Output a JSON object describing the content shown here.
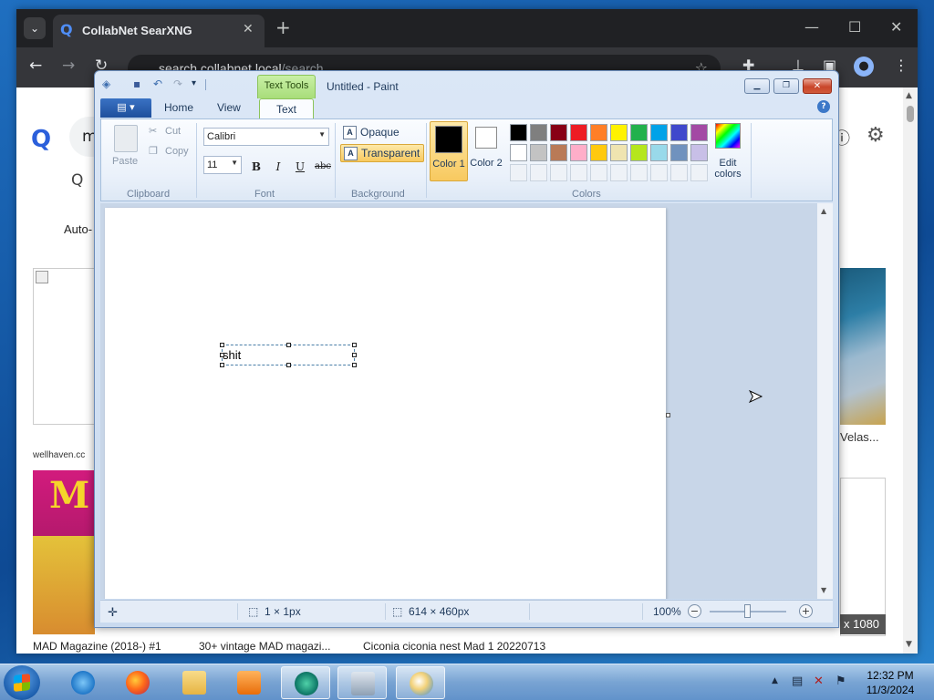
{
  "browser": {
    "tab_title": "CollabNet SearXNG",
    "tab_close": "✕",
    "new_tab": "+",
    "omnibox_host": "search.collabnet.local",
    "omnibox_path": "/search",
    "search_query_fragment": "m",
    "safe_search_label": "Auto-",
    "tile_source": "wellhaven.cc",
    "right_caption": "Velas...",
    "resolution_badge": "x 1080",
    "captions": [
      "MAD Magazine (2018-) #1",
      "30+ vintage MAD magazi...",
      "Ciconia ciconia nest Mad 1 20220713"
    ]
  },
  "paint": {
    "title": "Untitled - Paint",
    "context_tab": "Text Tools",
    "tabs": {
      "home": "Home",
      "view": "View",
      "text": "Text"
    },
    "clipboard": {
      "paste": "Paste",
      "cut": "Cut",
      "copy": "Copy",
      "group": "Clipboard"
    },
    "font": {
      "family": "Calibri",
      "size": "11",
      "bold": "B",
      "italic": "I",
      "underline": "U",
      "strike": "abc",
      "group": "Font"
    },
    "background": {
      "opaque": "Opaque",
      "transparent": "Transparent",
      "group": "Background",
      "selected": "Transparent"
    },
    "colors": {
      "color1_label": "Color 1",
      "color2_label": "Color 2",
      "color1": "#000000",
      "color2": "#ffffff",
      "edit_label": "Edit colors",
      "group": "Colors",
      "palette_row1": [
        "#000000",
        "#7f7f7f",
        "#880015",
        "#ed1c24",
        "#ff7f27",
        "#fff200",
        "#22b14c",
        "#00a2e8",
        "#3f48cc",
        "#a349a4"
      ],
      "palette_row2": [
        "#ffffff",
        "#c3c3c3",
        "#b97a57",
        "#ffaec9",
        "#ffc90e",
        "#efe4b0",
        "#b5e61d",
        "#99d9ea",
        "#7092be",
        "#c8bfe7"
      ]
    },
    "canvas_text": "shit",
    "status": {
      "selection_size": "1 × 1px",
      "image_size": "614 × 460px",
      "zoom": "100%"
    }
  },
  "taskbar": {
    "time": "12:32 PM",
    "date": "11/3/2024"
  }
}
